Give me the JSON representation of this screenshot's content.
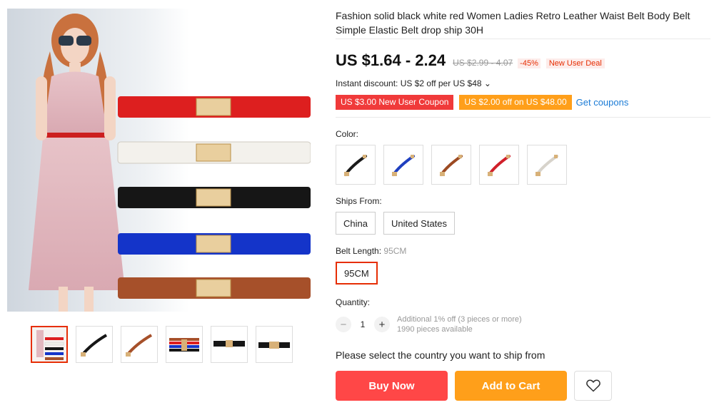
{
  "product": {
    "title": "Fashion solid black white red Women Ladies Retro Leather Waist Belt Body Belt Simple Elastic Belt drop ship 30H"
  },
  "pricing": {
    "price": "US $1.64 - 2.24",
    "old_price": "US $2.99 - 4.07",
    "discount": "-45%",
    "deal_badge": "New User Deal",
    "instant_discount": "Instant discount: US $2 off per US $48 ⌄"
  },
  "coupons": {
    "new_user": "US $3.00 New User Coupon",
    "off": "US $2.00 off on US $48.00",
    "get_label": "Get coupons"
  },
  "color": {
    "label": "Color:",
    "options": [
      {
        "name": "black",
        "color": "#1a1a1a"
      },
      {
        "name": "blue",
        "color": "#1f3fbf"
      },
      {
        "name": "brown",
        "color": "#9c4a22"
      },
      {
        "name": "red",
        "color": "#d0202a"
      },
      {
        "name": "white",
        "color": "#ecebe6"
      }
    ]
  },
  "ships_from": {
    "label": "Ships From:",
    "options": [
      "China",
      "United States"
    ]
  },
  "belt_length": {
    "label": "Belt Length: ",
    "selected_value": "95CM",
    "options": [
      "95CM"
    ]
  },
  "quantity": {
    "label": "Quantity:",
    "minus": "−",
    "value": "1",
    "plus": "+",
    "note_line1": "Additional 1% off (3 pieces or more)",
    "note_line2": "1990 pieces available"
  },
  "ship_message": "Please select the country you want to ship from",
  "actions": {
    "buy_now": "Buy Now",
    "add_to_cart": "Add to Cart"
  },
  "gallery": {
    "main_belts": [
      {
        "name": "red",
        "color": "#dd1f1f"
      },
      {
        "name": "white",
        "color": "#f3f1ec"
      },
      {
        "name": "black",
        "color": "#161616"
      },
      {
        "name": "blue",
        "color": "#1434c9"
      },
      {
        "name": "brown",
        "color": "#a6502a"
      }
    ],
    "thumbnails": [
      "model-with-belts",
      "black-belt",
      "brown-belt",
      "belt-stack",
      "black-belt-flat",
      "black-belt-buckle"
    ]
  },
  "colors": {
    "accent_red": "#e62e04",
    "buy_red": "#ff4747",
    "cart_orange": "#ff9f1a",
    "link_blue": "#1a7bd6"
  }
}
